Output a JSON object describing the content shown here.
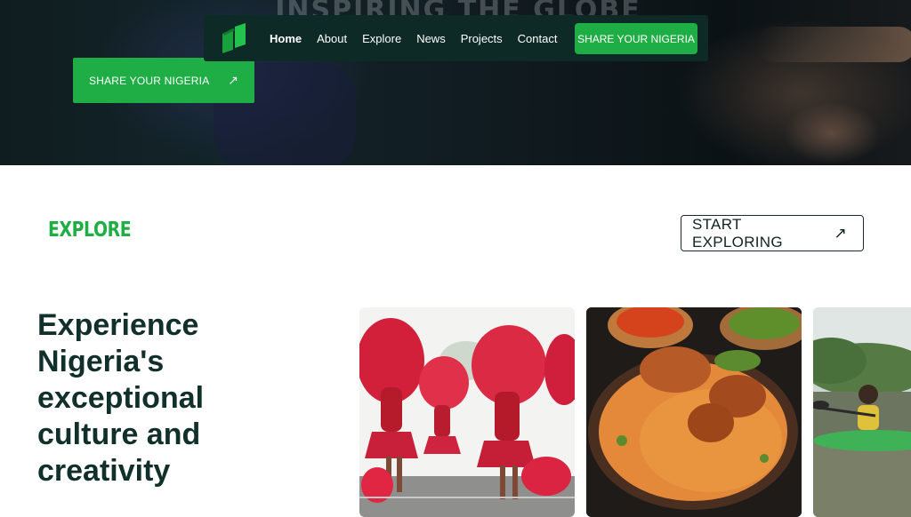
{
  "hero": {
    "title": "INSPIRING THE GLOBE",
    "cta_label": "SHARE YOUR NIGERIA",
    "cta_icon": "arrow-up-right-icon"
  },
  "navbar": {
    "logo_icon": "nigeria-logo-icon",
    "links": [
      "Home",
      "About",
      "Explore",
      "News",
      "Projects",
      "Contact"
    ],
    "active": "Home",
    "cta_label": "SHARE YOUR NIGERIA"
  },
  "explore": {
    "label": "EXPLORE",
    "button_label": "START EXPLORING",
    "button_icon": "arrow-up-right-icon",
    "headline": "Experience Nigeria's exceptional culture and creativity",
    "cards": [
      {
        "name": "carnival-dancers-image"
      },
      {
        "name": "jollof-rice-image"
      },
      {
        "name": "kayaking-image"
      }
    ]
  },
  "colors": {
    "brand_green": "#1fae45",
    "navbar_bg": "#0d2a26",
    "headline_text": "#12302b"
  }
}
